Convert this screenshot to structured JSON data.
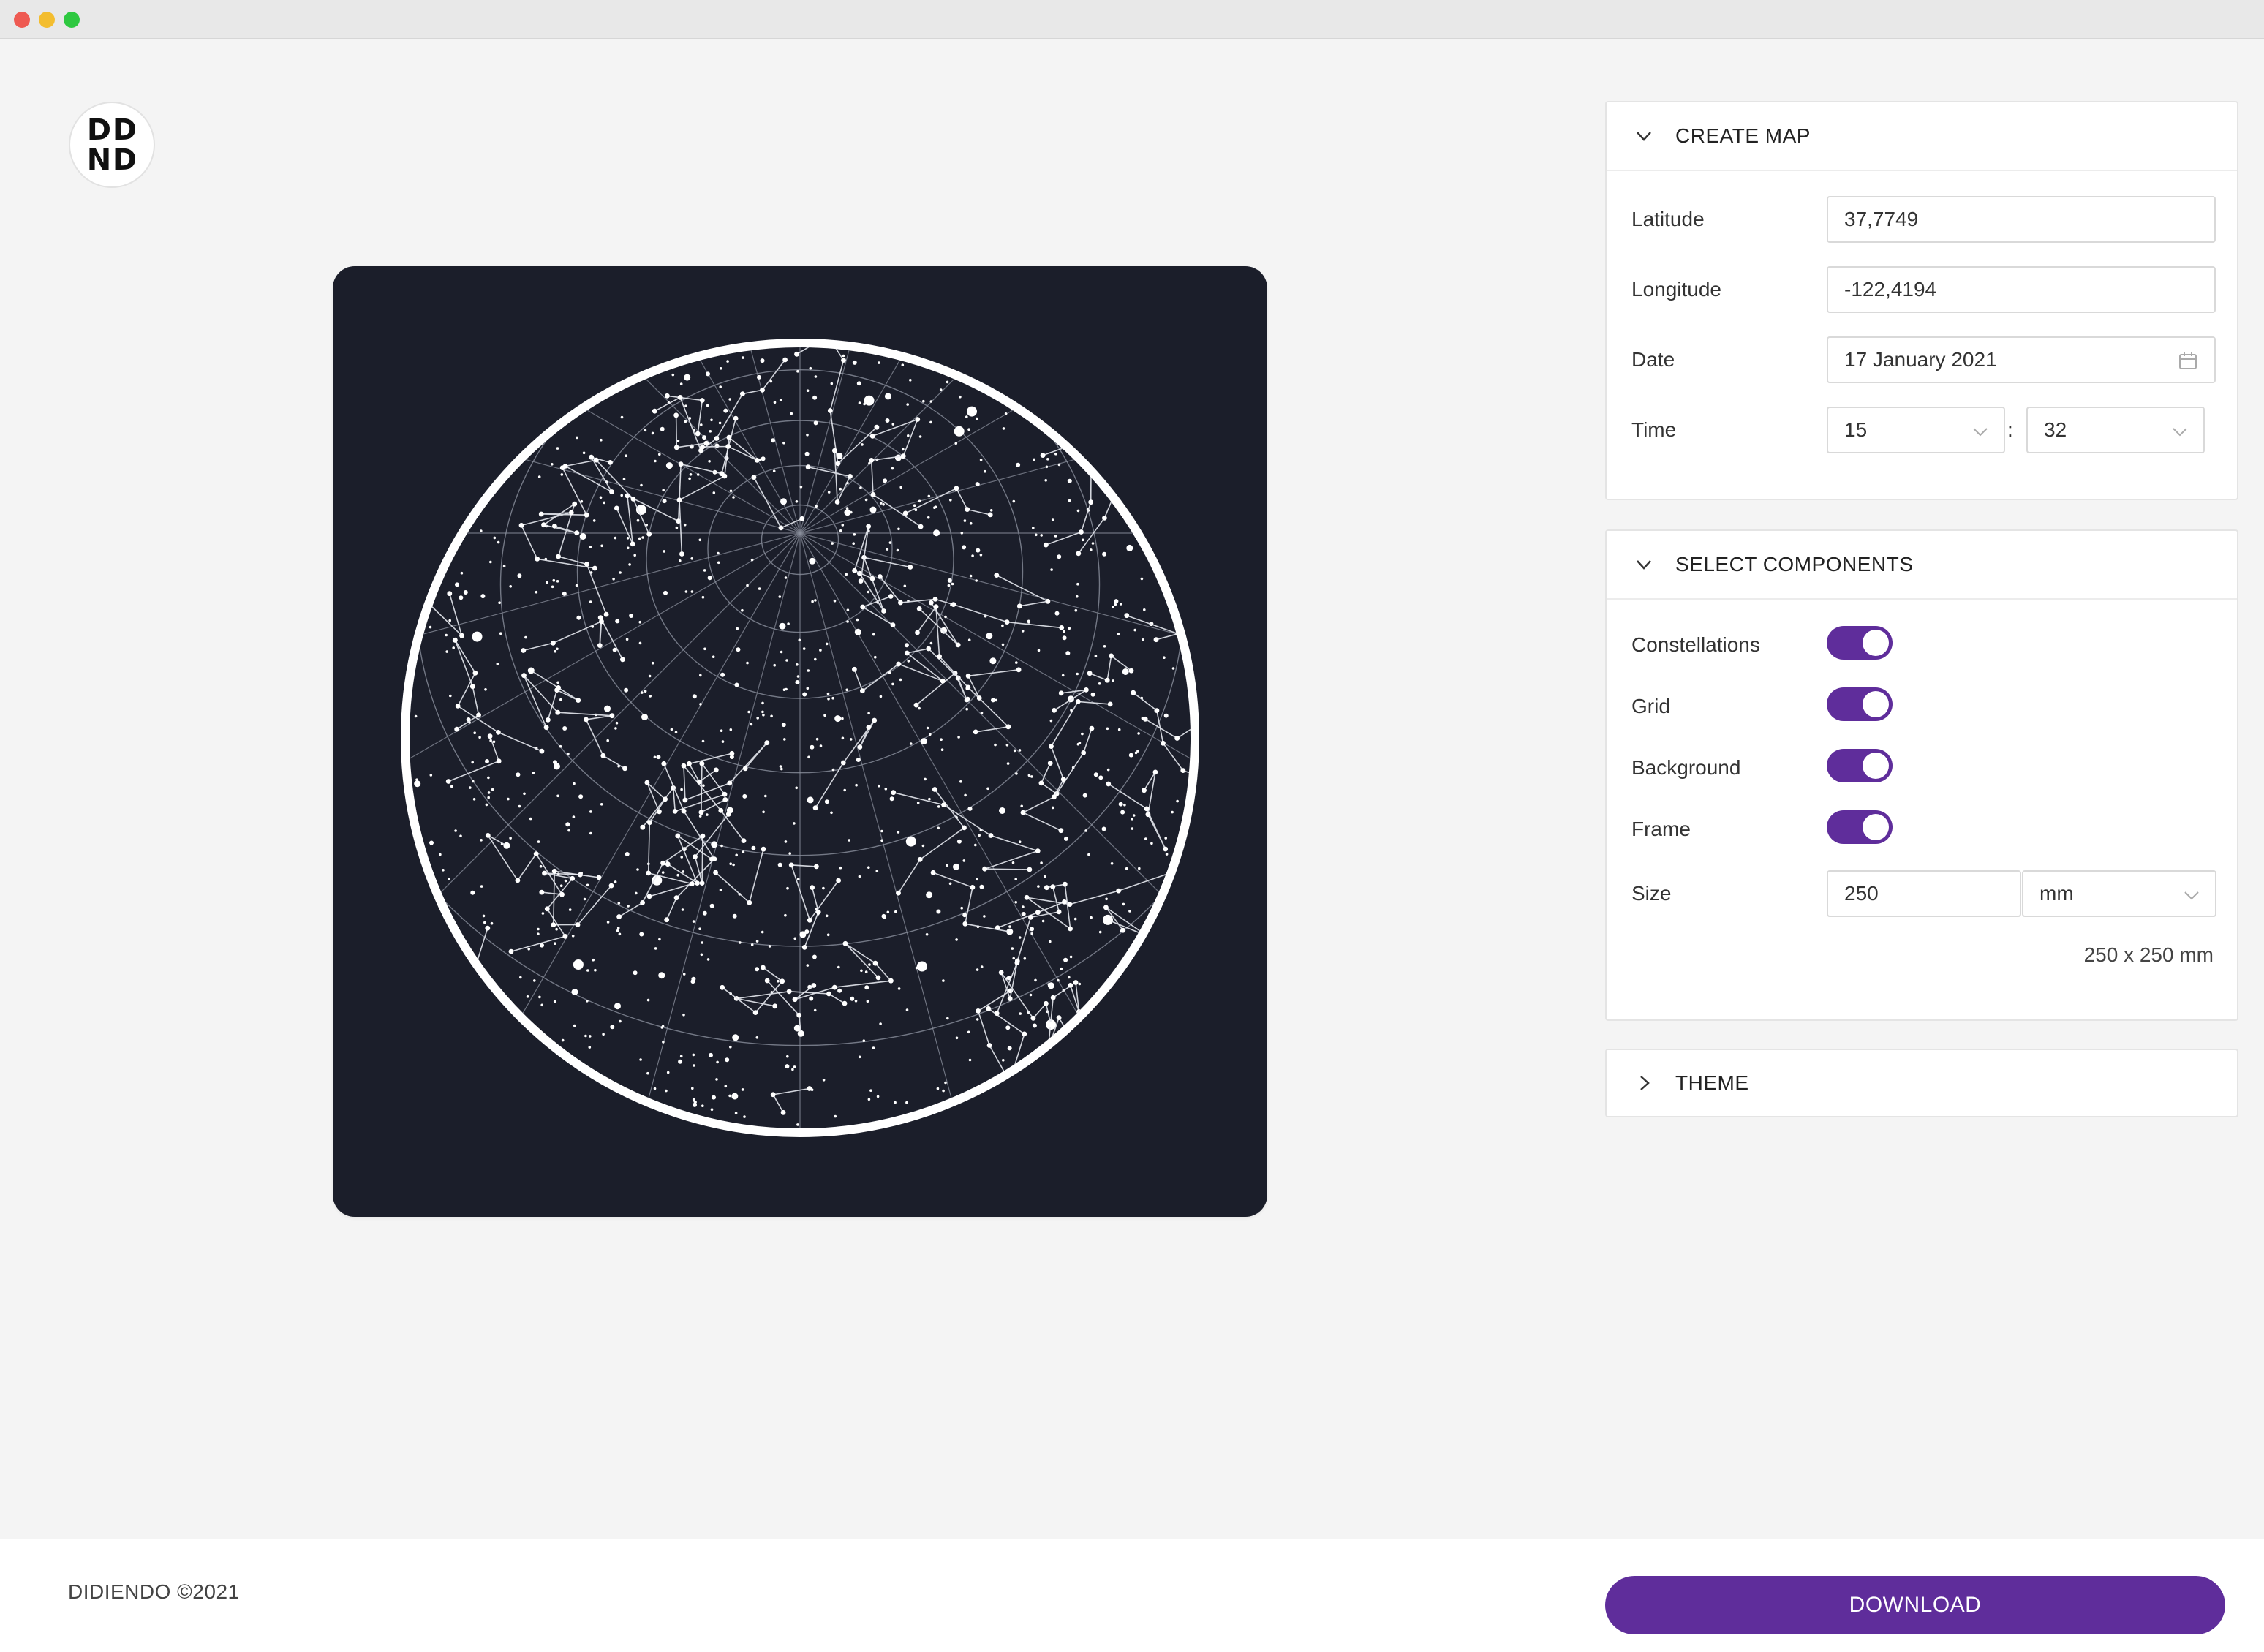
{
  "window": {
    "controls": [
      "close",
      "minimize",
      "maximize"
    ]
  },
  "logo": {
    "letters": [
      "D",
      "D",
      "N",
      "D"
    ]
  },
  "map_preview": {
    "background_color": "#1b1e2a",
    "frame_color": "#ffffff",
    "shows": [
      "constellations",
      "grid",
      "stars",
      "frame"
    ]
  },
  "create_map": {
    "title": "CREATE MAP",
    "expanded": true,
    "latitude": {
      "label": "Latitude",
      "value": "37,7749"
    },
    "longitude": {
      "label": "Longitude",
      "value": "-122,4194"
    },
    "date": {
      "label": "Date",
      "value": "17 January 2021",
      "icon": "calendar-icon"
    },
    "time": {
      "label": "Time",
      "hour": "15",
      "separator": ":",
      "minute": "32"
    }
  },
  "select_components": {
    "title": "SELECT COMPONENTS",
    "expanded": true,
    "toggles": [
      {
        "label": "Constellations",
        "on": true
      },
      {
        "label": "Grid",
        "on": true
      },
      {
        "label": "Background",
        "on": true
      },
      {
        "label": "Frame",
        "on": true
      }
    ],
    "size": {
      "label": "Size",
      "value": "250",
      "unit": "mm",
      "summary": "250 x 250 mm"
    }
  },
  "theme": {
    "title": "THEME",
    "expanded": false
  },
  "footer": {
    "copyright": "DIDIENDO ©2021",
    "download_label": "DOWNLOAD"
  },
  "colors": {
    "accent": "#5f2d9b",
    "page_bg": "#f4f4f4",
    "panel_bg": "#ffffff"
  }
}
